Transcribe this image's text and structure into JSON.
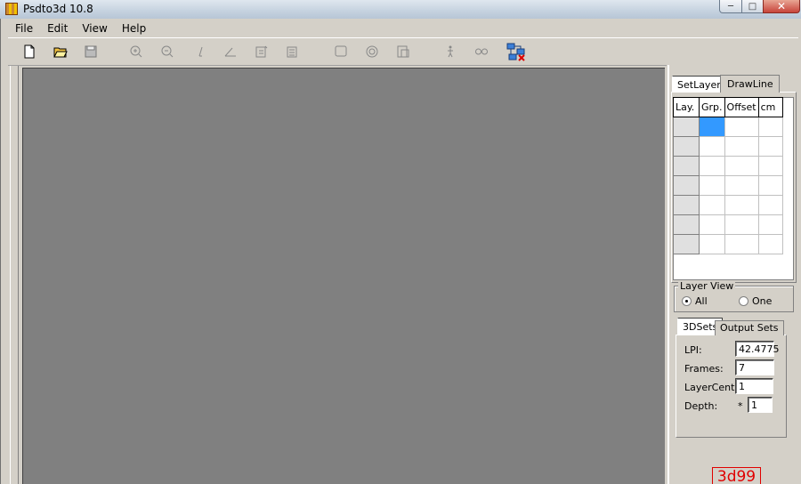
{
  "window": {
    "title": "Psdto3d 10.8",
    "min": "─",
    "max": "□",
    "close": "✕"
  },
  "menu": [
    "File",
    "Edit",
    "View",
    "Help"
  ],
  "toolbar": [
    "new-file-icon",
    "open-folder-icon",
    "save-icon",
    "zoom-in-icon",
    "zoom-out-icon",
    "draw-tool-icon",
    "angle-tool-icon",
    "edit-layer-icon",
    "layer-settings-icon",
    "frame-icon",
    "target-icon",
    "preview-icon",
    "figure-icon",
    "glasses-icon",
    "network-close-icon"
  ],
  "setlayer": {
    "tabs": [
      "SetLayer",
      "DrawLine"
    ],
    "columns": [
      "Lay.",
      "Grp.",
      "Offset",
      "cm"
    ],
    "rows": [
      [
        "",
        "",
        "",
        ""
      ],
      [
        "",
        "",
        "",
        ""
      ],
      [
        "",
        "",
        "",
        ""
      ],
      [
        "",
        "",
        "",
        ""
      ],
      [
        "",
        "",
        "",
        ""
      ],
      [
        "",
        "",
        "",
        ""
      ],
      [
        "",
        "",
        "",
        ""
      ]
    ]
  },
  "layer_view": {
    "title": "Layer View",
    "options": [
      "All",
      "One"
    ],
    "selected": "All"
  },
  "sets": {
    "tabs": [
      "3DSets",
      "Output Sets"
    ],
    "lpi_label": "LPI:",
    "lpi": "42.4775",
    "frames_label": "Frames:",
    "frames": "7",
    "layercenter_label": "LayerCenter:",
    "layercenter": "1",
    "depth_label": "Depth:",
    "depth_sign": "*",
    "depth": "1"
  },
  "brand": "3d99"
}
